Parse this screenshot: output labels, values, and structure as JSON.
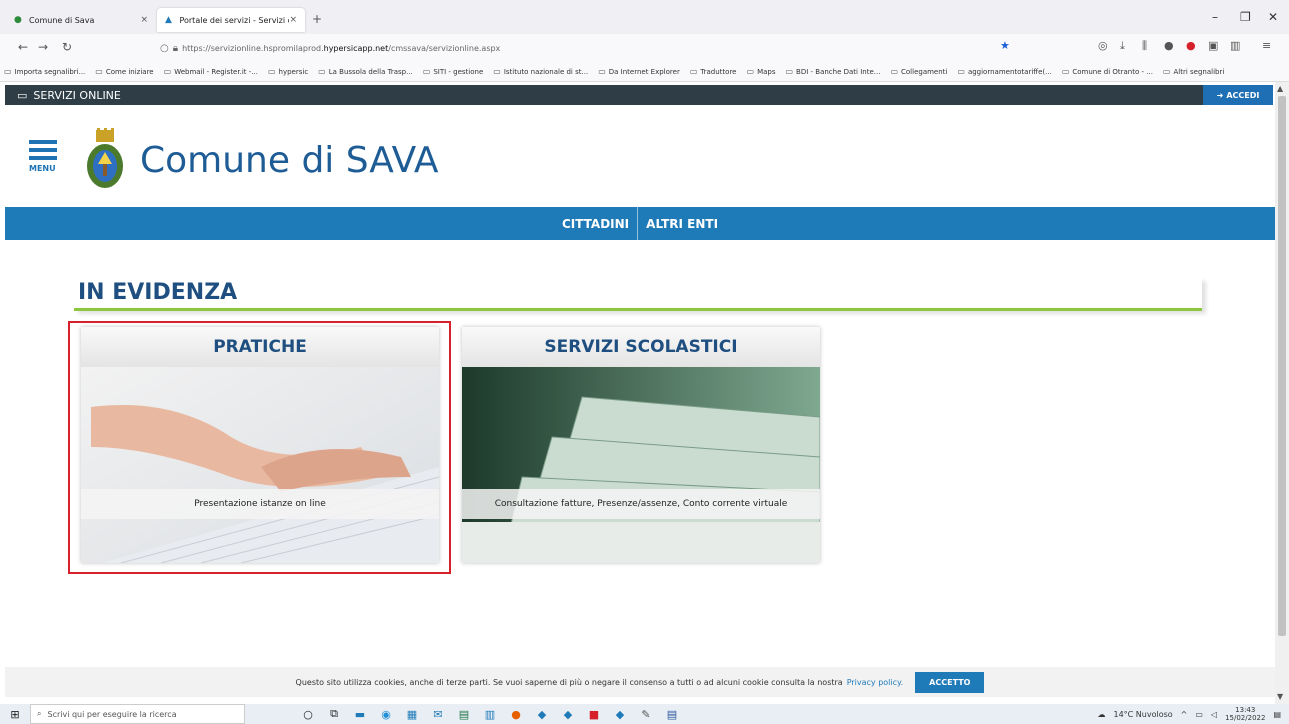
{
  "browser": {
    "tabs": [
      {
        "label": "Comune di Sava",
        "close": "×"
      },
      {
        "label": "Portale dei servizi - Servizi onlin",
        "close": "×"
      }
    ],
    "new_tab": "+",
    "url_prefix": "https://servizionline.hspromilaprod.",
    "url_domain": "hypersicapp.net",
    "url_path": "/cmssava/servizionline.aspx",
    "bookmarks": [
      "Importa segnalibri...",
      "Come iniziare",
      "Webmail - Register.it -...",
      "hypersic",
      "La Bussola della Trasp...",
      "SITI - gestione",
      "Istituto nazionale di st...",
      "Da Internet Explorer",
      "Traduttore",
      "Maps",
      "BDI - Banche Dati Inte...",
      "Collegamenti",
      "aggiornamentotariffe(...",
      "Comune di Otranto - ...",
      "Altri segnalibri"
    ]
  },
  "site": {
    "topbar_label": "SERVIZI ONLINE",
    "accedi_label": "ACCEDI",
    "menu_label": "MENU",
    "title": "Comune di SAVA",
    "nav": [
      "CITTADINI",
      "ALTRI ENTI"
    ],
    "section_title": "IN EVIDENZA",
    "cards": [
      {
        "title": "PRATICHE",
        "desc": "Presentazione istanze on line"
      },
      {
        "title": "SERVIZI SCOLASTICI",
        "desc": "Consultazione fatture, Presenze/assenze, Conto corrente virtuale"
      }
    ],
    "cookie": {
      "text": "Questo sito utilizza cookies, anche di terze parti. Se vuoi saperne di più o negare il consenso a tutti o ad alcuni cookie consulta la nostra",
      "link": "Privacy policy.",
      "button": "ACCETTO"
    }
  },
  "taskbar": {
    "search_placeholder": "Scrivi qui per eseguire la ricerca",
    "weather": "14°C Nuvoloso",
    "time": "13:43",
    "date": "15/02/2022"
  },
  "colors": {
    "brand_blue": "#1f7ab8",
    "title_blue": "#1e5c96",
    "dark_bar": "#2f3e46",
    "accent_green": "#8dc63f",
    "highlight_red": "#d6202a"
  }
}
